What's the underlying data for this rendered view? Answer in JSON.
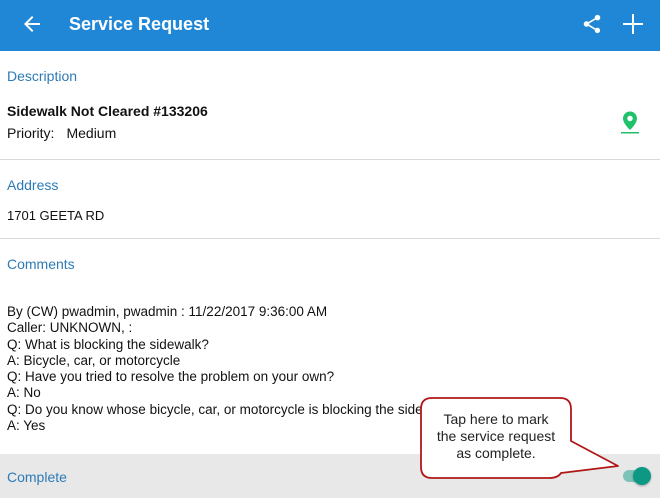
{
  "appbar": {
    "title": "Service Request",
    "back_icon": "arrow-back-icon",
    "share_icon": "share-icon",
    "add_icon": "plus-icon",
    "color": "#1f87d6"
  },
  "description": {
    "label": "Description",
    "title": "Sidewalk Not Cleared #133206",
    "priority_label": "Priority:",
    "priority_value": "Medium",
    "map_icon": "map-pin-icon",
    "map_icon_color": "#1fc26a"
  },
  "address": {
    "label": "Address",
    "value": "1701 GEETA RD"
  },
  "comments": {
    "label": "Comments",
    "lines": [
      "By (CW) pwadmin, pwadmin : 11/22/2017 9:36:00 AM",
      "Caller: UNKNOWN, :",
      "Q: What is blocking the sidewalk?",
      "A: Bicycle, car, or motorcycle",
      "Q: Have you tried to resolve the problem on your own?",
      "A: No",
      "Q: Do you know whose bicycle, car, or motorcycle is blocking the sidewalk?",
      "A: Yes"
    ]
  },
  "complete": {
    "label": "Complete",
    "toggle_on": true,
    "toggle_color": "#0d9886"
  },
  "callout": {
    "line1": "Tap here to mark",
    "line2": "the service request",
    "line3": "as complete.",
    "border_color": "#b01818"
  }
}
